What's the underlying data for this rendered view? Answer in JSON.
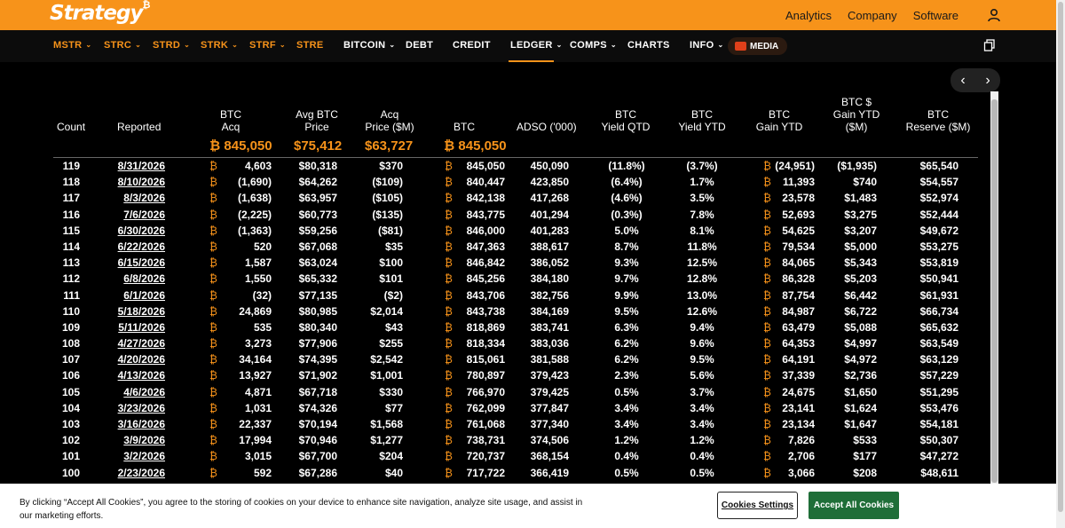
{
  "brand": {
    "logo_text": "Strategy",
    "logo_mark": "₿"
  },
  "top_links": [
    "Analytics",
    "Company",
    "Software"
  ],
  "nav": [
    {
      "label": "MSTR",
      "dropdown": true,
      "style": "orange"
    },
    {
      "label": "STRC",
      "dropdown": true,
      "style": "orange"
    },
    {
      "label": "STRD",
      "dropdown": true,
      "style": "orange"
    },
    {
      "label": "STRK",
      "dropdown": true,
      "style": "orange"
    },
    {
      "label": "STRF",
      "dropdown": true,
      "style": "orange"
    },
    {
      "label": "STRE",
      "dropdown": false,
      "style": "orange"
    },
    {
      "label": "BITCOIN",
      "dropdown": true,
      "style": "white"
    },
    {
      "label": "DEBT",
      "dropdown": false,
      "style": "white"
    },
    {
      "label": "CREDIT",
      "dropdown": false,
      "style": "white"
    },
    {
      "label": "LEDGER",
      "dropdown": true,
      "style": "white"
    },
    {
      "label": "COMPS",
      "dropdown": true,
      "style": "white"
    },
    {
      "label": "CHARTS",
      "dropdown": false,
      "style": "white"
    },
    {
      "label": "INFO",
      "dropdown": true,
      "style": "white"
    }
  ],
  "media_label": "MEDIA",
  "pager": {
    "prev": "‹",
    "next": "›"
  },
  "table": {
    "headers": {
      "count": "Count",
      "reported": "Reported",
      "btc_acq": [
        "BTC",
        "Acq"
      ],
      "avg_btc_price": [
        "Avg BTC",
        "Price"
      ],
      "acq_price": [
        "Acq",
        "Price ($M)"
      ],
      "btc": "BTC",
      "adso": "ADSO ('000)",
      "btc_yield_qtd": [
        "BTC",
        "Yield QTD"
      ],
      "btc_yield_ytd": [
        "BTC",
        "Yield YTD"
      ],
      "btc_gain_ytd": [
        "BTC",
        "Gain YTD"
      ],
      "btc_usd_gain_ytd": [
        "BTC $",
        "Gain YTD",
        "($M)"
      ],
      "btc_reserve": [
        "BTC",
        "Reserve ($M)"
      ]
    },
    "totals": {
      "btc_acq": "₿ 845,050",
      "avg_btc_price": "$75,412",
      "acq_price": "$63,727",
      "btc": "₿ 845,050"
    },
    "rows": [
      {
        "count": "119",
        "reported": "8/31/2026",
        "btc_acq": "4,603",
        "avg_price": "$80,318",
        "acq_price": "$370",
        "btc": "845,050",
        "adso": "450,090",
        "yield_qtd": "(11.8%)",
        "yield_ytd": "(3.7%)",
        "gain_ytd": "(24,951)",
        "usd_gain": "($1,935)",
        "reserve": "$65,540"
      },
      {
        "count": "118",
        "reported": "8/10/2026",
        "btc_acq": "(1,690)",
        "avg_price": "$64,262",
        "acq_price": "($109)",
        "btc": "840,447",
        "adso": "423,850",
        "yield_qtd": "(6.4%)",
        "yield_ytd": "1.7%",
        "gain_ytd": "11,393",
        "usd_gain": "$740",
        "reserve": "$54,557"
      },
      {
        "count": "117",
        "reported": "8/3/2026",
        "btc_acq": "(1,638)",
        "avg_price": "$63,957",
        "acq_price": "($105)",
        "btc": "842,138",
        "adso": "417,268",
        "yield_qtd": "(4.6%)",
        "yield_ytd": "3.5%",
        "gain_ytd": "23,578",
        "usd_gain": "$1,483",
        "reserve": "$52,974"
      },
      {
        "count": "116",
        "reported": "7/6/2026",
        "btc_acq": "(2,225)",
        "avg_price": "$60,773",
        "acq_price": "($135)",
        "btc": "843,775",
        "adso": "401,294",
        "yield_qtd": "(0.3%)",
        "yield_ytd": "7.8%",
        "gain_ytd": "52,693",
        "usd_gain": "$3,275",
        "reserve": "$52,444"
      },
      {
        "count": "115",
        "reported": "6/30/2026",
        "btc_acq": "(1,363)",
        "avg_price": "$59,256",
        "acq_price": "($81)",
        "btc": "846,000",
        "adso": "401,283",
        "yield_qtd": "5.0%",
        "yield_ytd": "8.1%",
        "gain_ytd": "54,625",
        "usd_gain": "$3,207",
        "reserve": "$49,672"
      },
      {
        "count": "114",
        "reported": "6/22/2026",
        "btc_acq": "520",
        "avg_price": "$67,068",
        "acq_price": "$35",
        "btc": "847,363",
        "adso": "388,617",
        "yield_qtd": "8.7%",
        "yield_ytd": "11.8%",
        "gain_ytd": "79,534",
        "usd_gain": "$5,000",
        "reserve": "$53,275"
      },
      {
        "count": "113",
        "reported": "6/15/2026",
        "btc_acq": "1,587",
        "avg_price": "$63,024",
        "acq_price": "$100",
        "btc": "846,842",
        "adso": "386,052",
        "yield_qtd": "9.3%",
        "yield_ytd": "12.5%",
        "gain_ytd": "84,065",
        "usd_gain": "$5,343",
        "reserve": "$53,819"
      },
      {
        "count": "112",
        "reported": "6/8/2026",
        "btc_acq": "1,550",
        "avg_price": "$65,332",
        "acq_price": "$101",
        "btc": "845,256",
        "adso": "384,180",
        "yield_qtd": "9.7%",
        "yield_ytd": "12.8%",
        "gain_ytd": "86,328",
        "usd_gain": "$5,203",
        "reserve": "$50,941"
      },
      {
        "count": "111",
        "reported": "6/1/2026",
        "btc_acq": "(32)",
        "avg_price": "$77,135",
        "acq_price": "($2)",
        "btc": "843,706",
        "adso": "382,756",
        "yield_qtd": "9.9%",
        "yield_ytd": "13.0%",
        "gain_ytd": "87,754",
        "usd_gain": "$6,442",
        "reserve": "$61,931"
      },
      {
        "count": "110",
        "reported": "5/18/2026",
        "btc_acq": "24,869",
        "avg_price": "$80,985",
        "acq_price": "$2,014",
        "btc": "843,738",
        "adso": "384,169",
        "yield_qtd": "9.5%",
        "yield_ytd": "12.6%",
        "gain_ytd": "84,987",
        "usd_gain": "$6,722",
        "reserve": "$66,734"
      },
      {
        "count": "109",
        "reported": "5/11/2026",
        "btc_acq": "535",
        "avg_price": "$80,340",
        "acq_price": "$43",
        "btc": "818,869",
        "adso": "383,741",
        "yield_qtd": "6.3%",
        "yield_ytd": "9.4%",
        "gain_ytd": "63,479",
        "usd_gain": "$5,088",
        "reserve": "$65,632"
      },
      {
        "count": "108",
        "reported": "4/27/2026",
        "btc_acq": "3,273",
        "avg_price": "$77,906",
        "acq_price": "$255",
        "btc": "818,334",
        "adso": "383,036",
        "yield_qtd": "6.2%",
        "yield_ytd": "9.6%",
        "gain_ytd": "64,353",
        "usd_gain": "$4,997",
        "reserve": "$63,549"
      },
      {
        "count": "107",
        "reported": "4/20/2026",
        "btc_acq": "34,164",
        "avg_price": "$74,395",
        "acq_price": "$2,542",
        "btc": "815,061",
        "adso": "381,588",
        "yield_qtd": "6.2%",
        "yield_ytd": "9.5%",
        "gain_ytd": "64,191",
        "usd_gain": "$4,972",
        "reserve": "$63,129"
      },
      {
        "count": "106",
        "reported": "4/13/2026",
        "btc_acq": "13,927",
        "avg_price": "$71,902",
        "acq_price": "$1,001",
        "btc": "780,897",
        "adso": "379,423",
        "yield_qtd": "2.3%",
        "yield_ytd": "5.6%",
        "gain_ytd": "37,339",
        "usd_gain": "$2,736",
        "reserve": "$57,229"
      },
      {
        "count": "105",
        "reported": "4/6/2026",
        "btc_acq": "4,871",
        "avg_price": "$67,718",
        "acq_price": "$330",
        "btc": "766,970",
        "adso": "379,425",
        "yield_qtd": "0.5%",
        "yield_ytd": "3.7%",
        "gain_ytd": "24,675",
        "usd_gain": "$1,650",
        "reserve": "$51,295"
      },
      {
        "count": "104",
        "reported": "3/23/2026",
        "btc_acq": "1,031",
        "avg_price": "$74,326",
        "acq_price": "$77",
        "btc": "762,099",
        "adso": "377,847",
        "yield_qtd": "3.4%",
        "yield_ytd": "3.4%",
        "gain_ytd": "23,141",
        "usd_gain": "$1,624",
        "reserve": "$53,476"
      },
      {
        "count": "103",
        "reported": "3/16/2026",
        "btc_acq": "22,337",
        "avg_price": "$70,194",
        "acq_price": "$1,568",
        "btc": "761,068",
        "adso": "377,340",
        "yield_qtd": "3.4%",
        "yield_ytd": "3.4%",
        "gain_ytd": "23,134",
        "usd_gain": "$1,647",
        "reserve": "$54,181"
      },
      {
        "count": "102",
        "reported": "3/9/2026",
        "btc_acq": "17,994",
        "avg_price": "$70,946",
        "acq_price": "$1,277",
        "btc": "738,731",
        "adso": "374,506",
        "yield_qtd": "1.2%",
        "yield_ytd": "1.2%",
        "gain_ytd": "7,826",
        "usd_gain": "$533",
        "reserve": "$50,307"
      },
      {
        "count": "101",
        "reported": "3/2/2026",
        "btc_acq": "3,015",
        "avg_price": "$67,700",
        "acq_price": "$204",
        "btc": "720,737",
        "adso": "368,154",
        "yield_qtd": "0.4%",
        "yield_ytd": "0.4%",
        "gain_ytd": "2,706",
        "usd_gain": "$177",
        "reserve": "$47,272"
      },
      {
        "count": "100",
        "reported": "2/23/2026",
        "btc_acq": "592",
        "avg_price": "$67,286",
        "acq_price": "$40",
        "btc": "717,722",
        "adso": "366,419",
        "yield_qtd": "0.5%",
        "yield_ytd": "0.5%",
        "gain_ytd": "3,066",
        "usd_gain": "$208",
        "reserve": "$48,611"
      }
    ]
  },
  "cookie": {
    "text": "By clicking “Accept All Cookies”, you agree to the storing of cookies on your device to enhance site navigation, analyze site usage, and assist in our marketing efforts.",
    "settings_label": "Cookies Settings",
    "accept_label": "Accept All Cookies"
  },
  "colors": {
    "accent": "#f7931a",
    "accept_green": "#1f6e38"
  },
  "icons": [
    "user-icon",
    "copy-icon",
    "media-icon",
    "chevron-left-icon",
    "chevron-right-icon",
    "chevron-down-icon"
  ]
}
